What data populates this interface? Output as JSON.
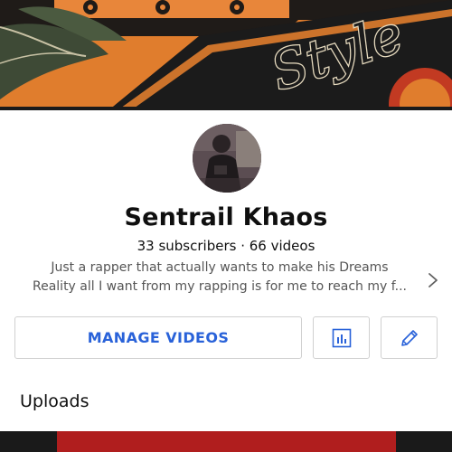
{
  "channel": {
    "name": "Sentrail Khaos",
    "stats": "33 subscribers · 66 videos",
    "description_line1": "Just a rapper that actually wants to make his Dreams",
    "description_line2": "Reality all I want from my rapping is for me to reach my f..."
  },
  "banner": {
    "text": "Style"
  },
  "actions": {
    "manage_label": "MANAGE VIDEOS",
    "analytics_icon": "analytics-icon",
    "edit_icon": "pencil-icon"
  },
  "sections": {
    "uploads_title": "Uploads"
  },
  "colors": {
    "accent": "#2962d9",
    "banner_orange": "#e07d2d",
    "banner_dark": "#1b1b1b",
    "thumbnail_red": "#b01e1e"
  }
}
